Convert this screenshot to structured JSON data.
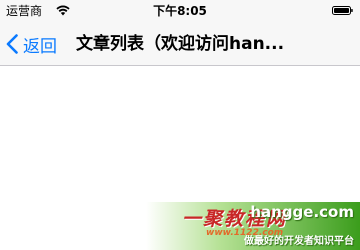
{
  "status_bar": {
    "carrier": "运营商",
    "time": "下午8:05"
  },
  "nav": {
    "back_label": "返回",
    "title": "文章列表（欢迎访问han..."
  },
  "watermark": {
    "logo_text": "一聚教程网",
    "domain": "hangge.com",
    "sub_text": "www.1122.com",
    "tagline": "做最好的开发者知识平台"
  },
  "colors": {
    "accent": "#0a7aff",
    "bar_background": "#f7f7f7",
    "watermark_green": "#3b9d1c",
    "watermark_red": "#c82727"
  }
}
